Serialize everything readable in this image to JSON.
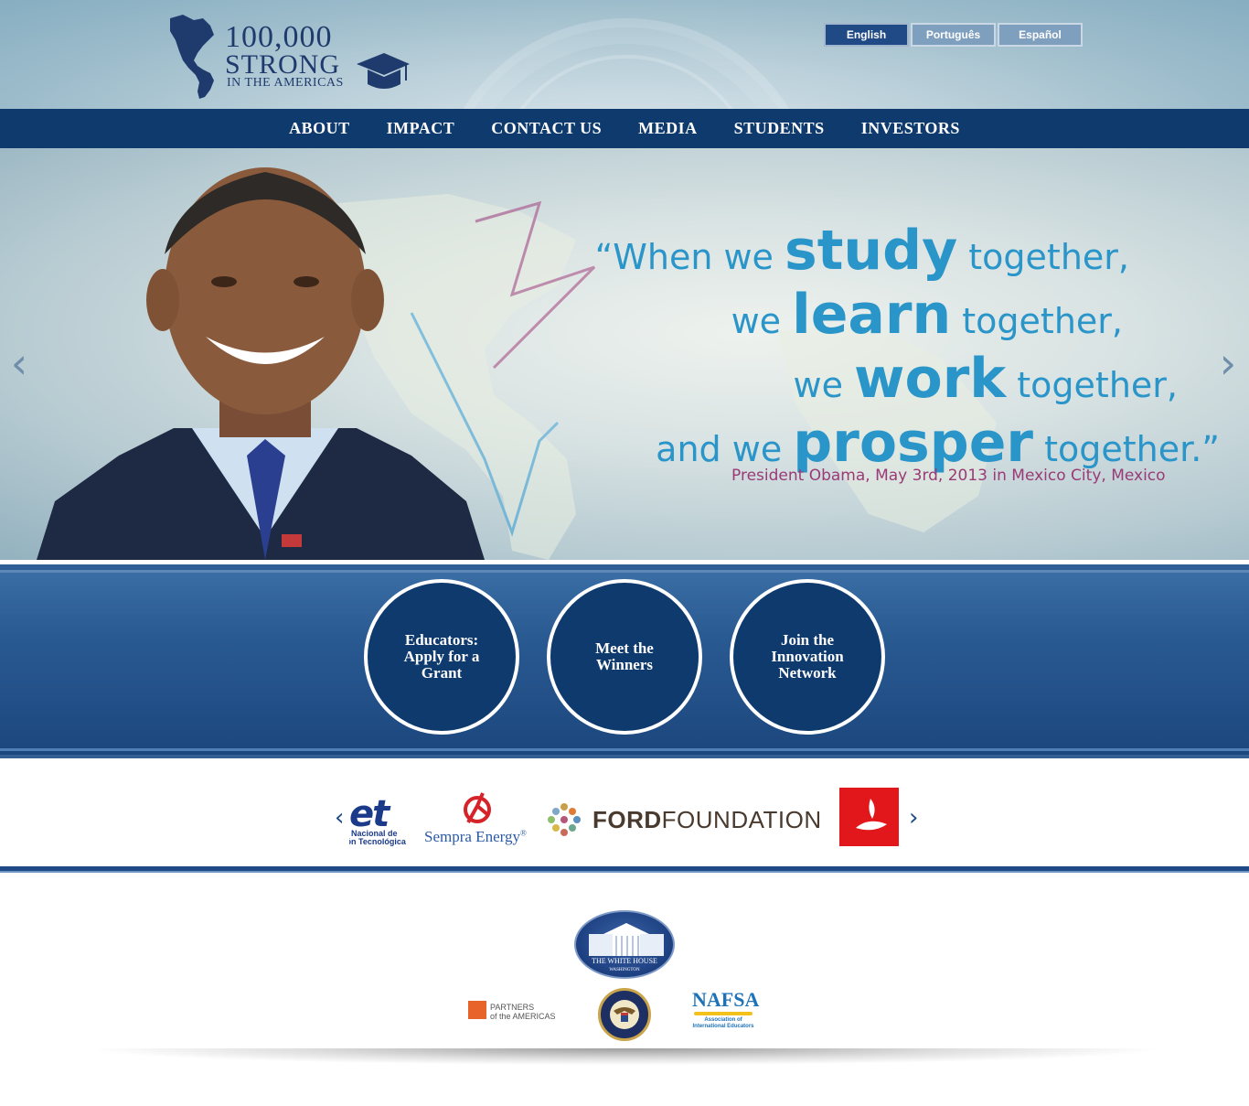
{
  "header": {
    "logo": {
      "line1": "100,000",
      "line2": "STRONG",
      "line3": "IN THE AMERICAS"
    },
    "languages": [
      {
        "label": "English",
        "active": true
      },
      {
        "label": "Português",
        "active": false
      },
      {
        "label": "Español",
        "active": false
      }
    ]
  },
  "nav": {
    "items": [
      "ABOUT",
      "IMPACT",
      "CONTACT US",
      "MEDIA",
      "STUDENTS",
      "INVESTORS"
    ]
  },
  "hero": {
    "prev_icon": "‹",
    "next_icon": "›",
    "quote": {
      "line1_a": "“When we ",
      "line1_b": "study",
      "line1_c": " together,",
      "line2_a": "we ",
      "line2_b": "learn",
      "line2_c": " together,",
      "line3_a": "we ",
      "line3_b": "work",
      "line3_c": " together,",
      "line4_a": "and we ",
      "line4_b": "prosper",
      "line4_c": " together.”"
    },
    "attribution": "President Obama, May 3rd, 2013 in Mexico City, Mexico"
  },
  "cta": {
    "items": [
      {
        "label": "Educators: Apply for a Grant"
      },
      {
        "label": "Meet the Winners"
      },
      {
        "label": "Join the Innovation Network"
      }
    ]
  },
  "sponsors": {
    "prev_icon": "‹",
    "next_icon": "›",
    "cet_big": "et",
    "cet_small_1": "o Nacional de",
    "cet_small_2": "ión Tecnológica",
    "sempra": "Sempra Energy",
    "sempra_mark": "®",
    "ford_a": "FORD",
    "ford_b": "FOUNDATION"
  },
  "partners": {
    "whitehouse_caption": "THE WHITE HOUSE",
    "whitehouse_sub": "WASHINGTON",
    "poa_line1": "PARTNERS",
    "poa_line2": "of the AMERICAS",
    "nafsa": "NAFSA",
    "nafsa_sub": "Association of International Educators"
  },
  "colors": {
    "navy": "#0f3a6e",
    "quote_blue": "#2a95c9",
    "attribution_purple": "#9a3a76",
    "santander_red": "#e2171b"
  }
}
